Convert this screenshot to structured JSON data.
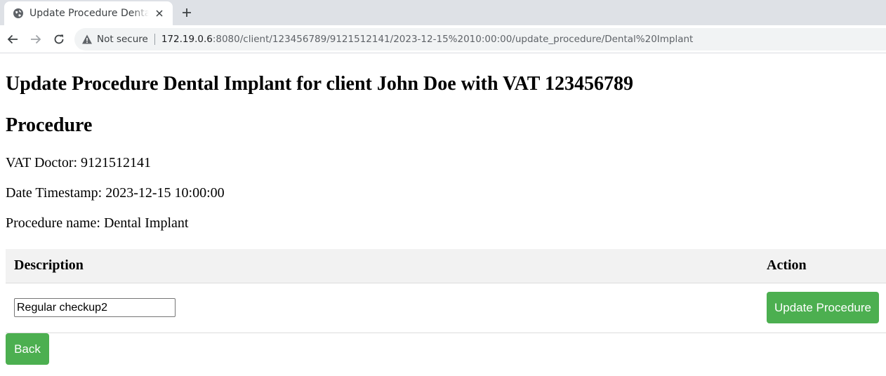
{
  "browser": {
    "tab_title": "Update Procedure Dental Implant",
    "not_secure_label": "Not secure",
    "url_host": "172.19.0.6",
    "url_rest": ":8080/client/123456789/9121512141/2023-12-15%2010:00:00/update_procedure/Dental%20Implant",
    "icons": {
      "tab": "globe-icon",
      "close": "close-icon",
      "new_tab": "plus-icon",
      "back": "back-arrow-icon",
      "forward": "forward-arrow-icon",
      "reload": "reload-icon",
      "security": "warning-icon"
    }
  },
  "page": {
    "heading": "Update Procedure Dental Implant for client John Doe with VAT 123456789",
    "subheading": "Procedure",
    "vat_doctor": "VAT Doctor: 9121512141",
    "date_timestamp": "Date Timestamp: 2023-12-15 10:00:00",
    "procedure_name": "Procedure name: Dental Implant",
    "table": {
      "headers": [
        "Description",
        "Action"
      ],
      "row": {
        "description_value": "Regular checkup2",
        "action_label": "Update Procedure"
      }
    },
    "back_label": "Back"
  },
  "colors": {
    "button_green": "#4caf50",
    "table_header_bg": "#f2f2f2"
  }
}
